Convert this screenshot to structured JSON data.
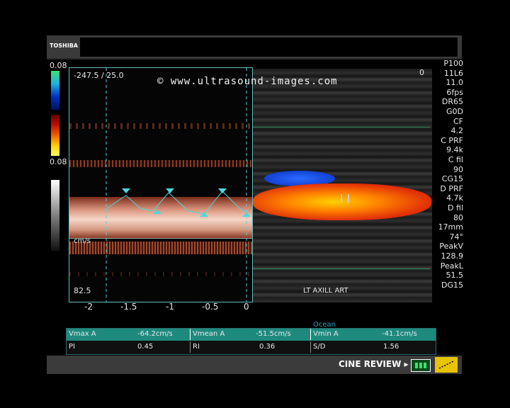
{
  "brand": "TOSHIBA",
  "watermark": "© www.ultrasound-images.com",
  "scale": {
    "top_value": "0.08",
    "bottom_value": "0.08"
  },
  "doppler": {
    "range_label": "-247.5 / 25.0",
    "velocity_unit": "cm/s",
    "bottom_value": "82.5",
    "time_ticks": [
      "-2",
      "-1.5",
      "-1",
      "-0.5",
      "0"
    ]
  },
  "bmode": {
    "annotation": "LT AXILL ART",
    "depth_zero": "0",
    "bottom_label": "Ocean"
  },
  "params": [
    "P100",
    "11L6",
    "11.0",
    "6fps",
    "DR65",
    "G0D",
    "CF",
    "4.2",
    "C PRF",
    "9.4k",
    "C fil",
    "90",
    "CG15",
    "D PRF",
    "4.7k",
    "D fil",
    "80",
    "17mm",
    "74°",
    "PeakV",
    "128.9",
    "PeakL",
    "51.5",
    "DG15"
  ],
  "measurements": {
    "row1": [
      {
        "label": "Vmax A",
        "value": "-64.2cm/s"
      },
      {
        "label": "Vmean A",
        "value": "-51.5cm/s"
      },
      {
        "label": "Vmin A",
        "value": "-41.1cm/s"
      }
    ],
    "row2": [
      {
        "label": "PI",
        "value": "0.45"
      },
      {
        "label": "RI",
        "value": "0.36"
      },
      {
        "label": "S/D",
        "value": "1.56"
      }
    ]
  },
  "footer": {
    "cine_label": "CINE REVIEW"
  },
  "colors": {
    "teal_header": "#1e8a7e",
    "cine_yellow": "#e8c400",
    "flow_red": "#e04010",
    "flow_blue": "#1040e0"
  }
}
